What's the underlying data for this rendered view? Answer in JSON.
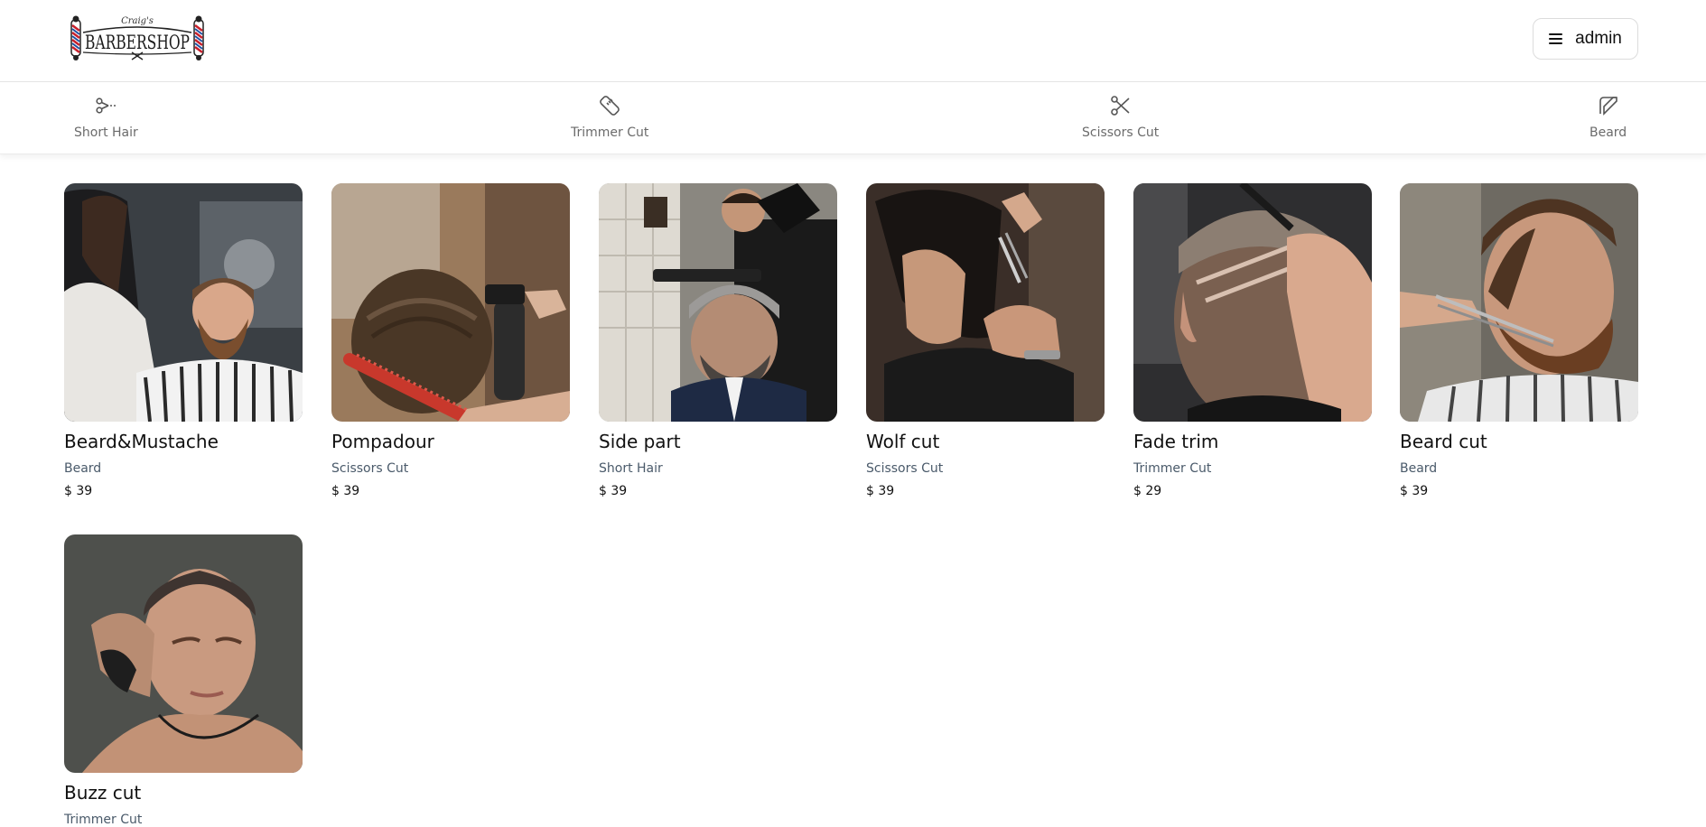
{
  "header": {
    "logo_text": "BARBERSHOP",
    "logo_script": "Craig's",
    "menu_user": "admin"
  },
  "categories": [
    {
      "label": "Short Hair",
      "icon": "clipper-icon"
    },
    {
      "label": "Trimmer Cut",
      "icon": "trimmer-icon"
    },
    {
      "label": "Scissors Cut",
      "icon": "scissors-icon"
    },
    {
      "label": "Beard",
      "icon": "razor-icon"
    }
  ],
  "services": [
    {
      "name": "Beard&Mustache",
      "category": "Beard",
      "price": "$ 39",
      "photo": "bearded-man-in-barber-chair-photo"
    },
    {
      "name": "Pompadour",
      "category": "Scissors Cut",
      "price": "$ 39",
      "photo": "hair-combing-and-spray-photo"
    },
    {
      "name": "Side part",
      "category": "Short Hair",
      "price": "$ 39",
      "photo": "hair-dryer-styling-photo"
    },
    {
      "name": "Wolf cut",
      "category": "Scissors Cut",
      "price": "$ 39",
      "photo": "scissors-cut-dark-hair-photo"
    },
    {
      "name": "Fade trim",
      "category": "Trimmer Cut",
      "price": "$ 29",
      "photo": "fade-design-trim-photo"
    },
    {
      "name": "Beard cut",
      "category": "Beard",
      "price": "$ 39",
      "photo": "beard-scissors-trim-photo"
    },
    {
      "name": "Buzz cut",
      "category": "Trimmer Cut",
      "price": "",
      "photo": "buzz-cut-portrait-photo"
    }
  ],
  "colors": {
    "pole_red": "#c8202c",
    "pole_blue": "#1f4fa0",
    "muted_text": "#6b6b6b",
    "category_text": "#4a5a6a"
  }
}
